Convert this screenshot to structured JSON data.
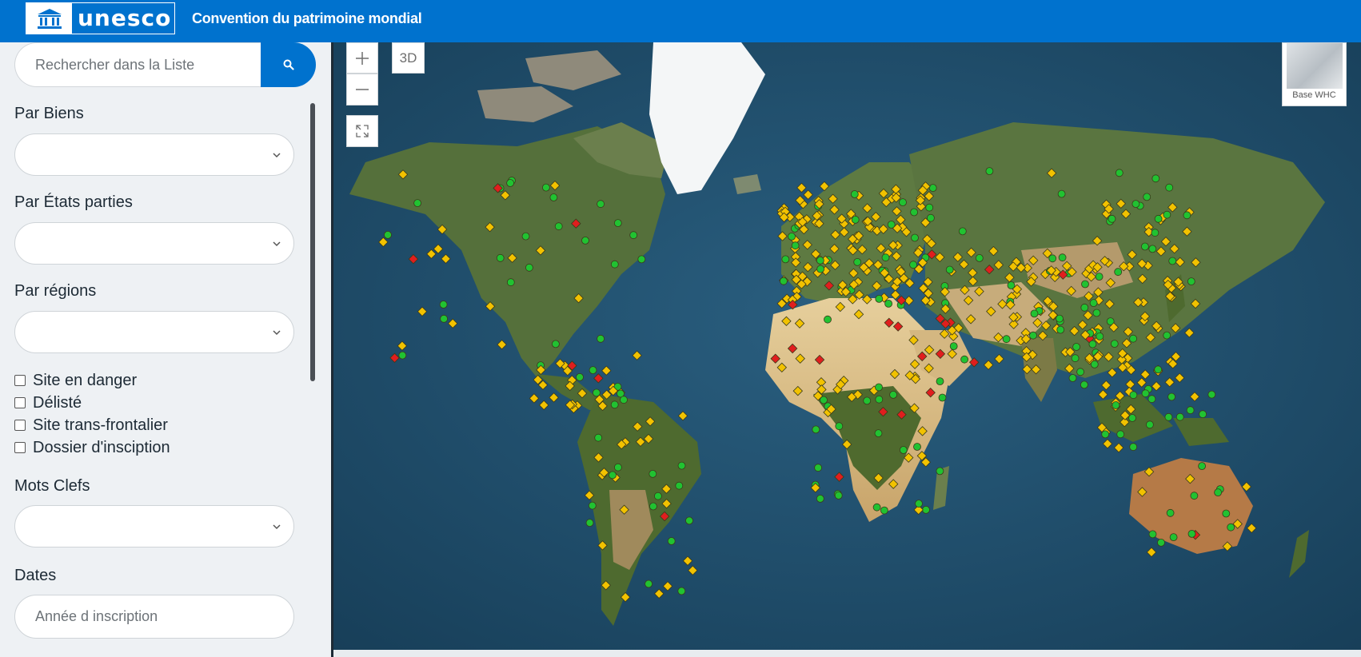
{
  "header": {
    "logo_text": "unesco",
    "title": "Convention du patrimoine mondial"
  },
  "sidebar": {
    "search_placeholder": "Rechercher dans la Liste",
    "filters": [
      {
        "label": "Par Biens",
        "value": ""
      },
      {
        "label": "Par États parties",
        "value": ""
      },
      {
        "label": "Par régions",
        "value": ""
      }
    ],
    "checkboxes": [
      {
        "label": "Site en danger",
        "checked": false
      },
      {
        "label": "Délisté",
        "checked": false
      },
      {
        "label": "Site trans-frontalier",
        "checked": false
      },
      {
        "label": "Dossier d'insciption",
        "checked": false
      }
    ],
    "keywords_label": "Mots Clefs",
    "keywords_value": "",
    "dates_label": "Dates",
    "dates_placeholder": "Année d inscription"
  },
  "map": {
    "zoom_in_icon": "plus-icon",
    "zoom_out_icon": "minus-icon",
    "fullscreen_icon": "expand-icon",
    "view_3d_label": "3D",
    "basemap_label": "Base WHC",
    "marker_colors": {
      "natural": "#21c231",
      "cultural": "#f2c200",
      "in_danger": "#e01e1e"
    },
    "marker_legend_note": ""
  }
}
